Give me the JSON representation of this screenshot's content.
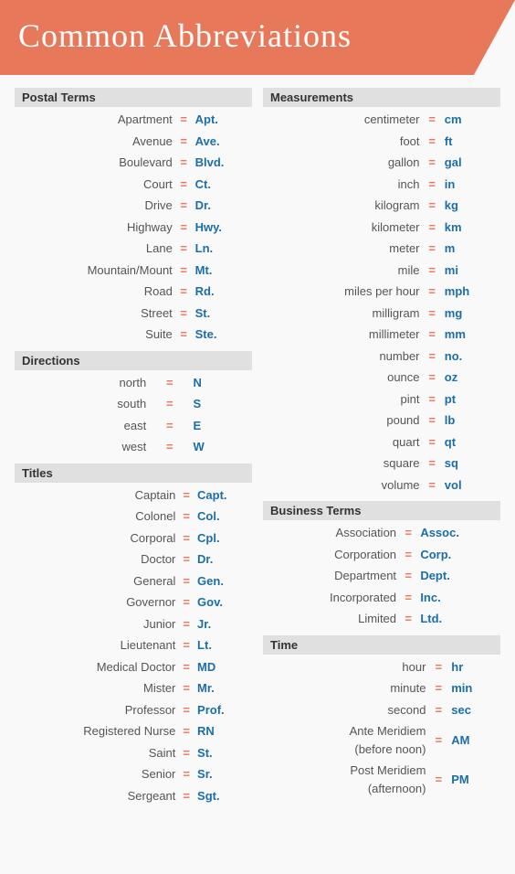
{
  "header": {
    "title": "Common Abbreviations"
  },
  "left_column": {
    "sections": [
      {
        "name": "Postal Terms",
        "items": [
          {
            "term": "Apartment",
            "abbr": "Apt."
          },
          {
            "term": "Avenue",
            "abbr": "Ave."
          },
          {
            "term": "Boulevard",
            "abbr": "Blvd."
          },
          {
            "term": "Court",
            "abbr": "Ct."
          },
          {
            "term": "Drive",
            "abbr": "Dr."
          },
          {
            "term": "Highway",
            "abbr": "Hwy."
          },
          {
            "term": "Lane",
            "abbr": "Ln."
          },
          {
            "term": "Mountain/Mount",
            "abbr": "Mt."
          },
          {
            "term": "Road",
            "abbr": "Rd."
          },
          {
            "term": "Street",
            "abbr": "St."
          },
          {
            "term": "Suite",
            "abbr": "Ste."
          }
        ]
      },
      {
        "name": "Directions",
        "items": [
          {
            "term": "north",
            "abbr": "N"
          },
          {
            "term": "south",
            "abbr": "S"
          },
          {
            "term": "east",
            "abbr": "E"
          },
          {
            "term": "west",
            "abbr": "W"
          }
        ]
      },
      {
        "name": "Titles",
        "items": [
          {
            "term": "Captain",
            "abbr": "Capt."
          },
          {
            "term": "Colonel",
            "abbr": "Col."
          },
          {
            "term": "Corporal",
            "abbr": "Cpl."
          },
          {
            "term": "Doctor",
            "abbr": "Dr."
          },
          {
            "term": "General",
            "abbr": "Gen."
          },
          {
            "term": "Governor",
            "abbr": "Gov."
          },
          {
            "term": "Junior",
            "abbr": "Jr."
          },
          {
            "term": "Lieutenant",
            "abbr": "Lt."
          },
          {
            "term": "Medical Doctor",
            "abbr": "MD"
          },
          {
            "term": "Mister",
            "abbr": "Mr."
          },
          {
            "term": "Professor",
            "abbr": "Prof."
          },
          {
            "term": "Registered Nurse",
            "abbr": "RN"
          },
          {
            "term": "Saint",
            "abbr": "St."
          },
          {
            "term": "Senior",
            "abbr": "Sr."
          },
          {
            "term": "Sergeant",
            "abbr": "Sgt."
          }
        ]
      }
    ]
  },
  "right_column": {
    "sections": [
      {
        "name": "Measurements",
        "items": [
          {
            "term": "centimeter",
            "abbr": "cm"
          },
          {
            "term": "foot",
            "abbr": "ft"
          },
          {
            "term": "gallon",
            "abbr": "gal"
          },
          {
            "term": "inch",
            "abbr": "in"
          },
          {
            "term": "kilogram",
            "abbr": "kg"
          },
          {
            "term": "kilometer",
            "abbr": "km"
          },
          {
            "term": "meter",
            "abbr": "m"
          },
          {
            "term": "mile",
            "abbr": "mi"
          },
          {
            "term": "miles per hour",
            "abbr": "mph"
          },
          {
            "term": "milligram",
            "abbr": "mg"
          },
          {
            "term": "millimeter",
            "abbr": "mm"
          },
          {
            "term": "number",
            "abbr": "no."
          },
          {
            "term": "ounce",
            "abbr": "oz"
          },
          {
            "term": "pint",
            "abbr": "pt"
          },
          {
            "term": "pound",
            "abbr": "lb"
          },
          {
            "term": "quart",
            "abbr": "qt"
          },
          {
            "term": "square",
            "abbr": "sq"
          },
          {
            "term": "volume",
            "abbr": "vol"
          }
        ]
      },
      {
        "name": "Business Terms",
        "items": [
          {
            "term": "Association",
            "abbr": "Assoc."
          },
          {
            "term": "Corporation",
            "abbr": "Corp."
          },
          {
            "term": "Department",
            "abbr": "Dept."
          },
          {
            "term": "Incorporated",
            "abbr": "Inc."
          },
          {
            "term": "Limited",
            "abbr": "Ltd."
          }
        ]
      },
      {
        "name": "Time",
        "simple_items": [
          {
            "term": "hour",
            "abbr": "hr"
          },
          {
            "term": "minute",
            "abbr": "min"
          },
          {
            "term": "second",
            "abbr": "sec"
          }
        ],
        "complex_items": [
          {
            "term_line1": "Ante Meridiem",
            "term_line2": "(before noon)",
            "abbr": "AM"
          },
          {
            "term_line1": "Post Meridiem",
            "term_line2": "(afternoon)",
            "abbr": "PM"
          }
        ]
      }
    ]
  },
  "equals_sign": "=",
  "colors": {
    "header_bg": "#e8785a",
    "section_bg": "#e0e0e0",
    "term_color": "#555555",
    "equals_color": "#e8785a",
    "abbr_color": "#1a6fa8"
  }
}
